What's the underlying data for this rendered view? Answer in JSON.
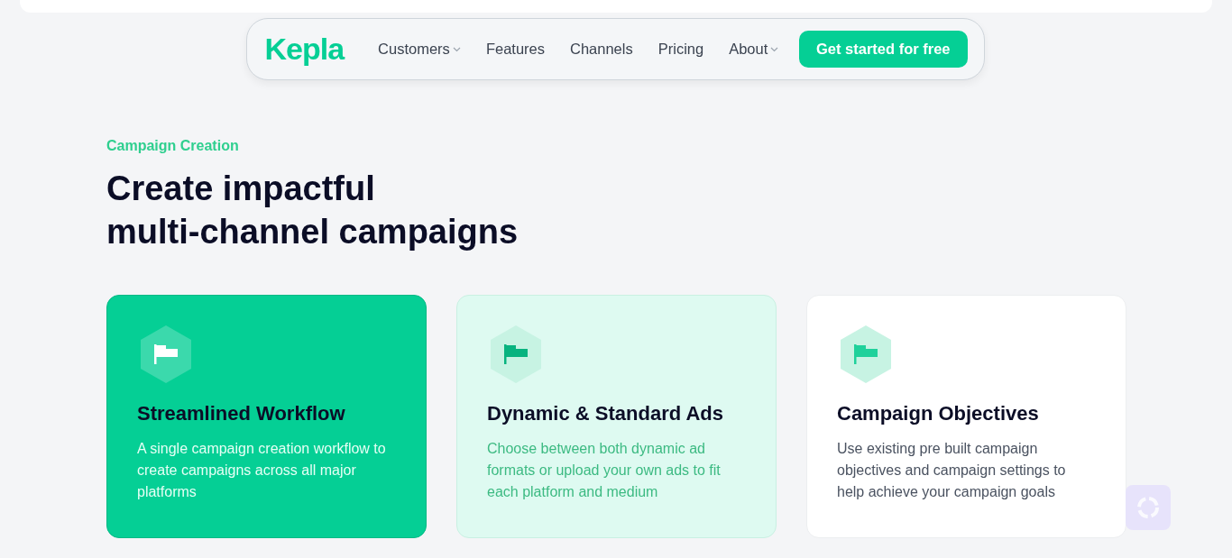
{
  "header": {
    "logo": "Kepla",
    "nav": [
      {
        "label": "Customers",
        "dropdown": true
      },
      {
        "label": "Features",
        "dropdown": false
      },
      {
        "label": "Channels",
        "dropdown": false
      },
      {
        "label": "Pricing",
        "dropdown": false
      },
      {
        "label": "About",
        "dropdown": true
      }
    ],
    "cta": "Get started for free"
  },
  "section": {
    "eyebrow": "Campaign Creation",
    "heading": [
      "Create impactful",
      "multi-channel campaigns"
    ],
    "cards": [
      {
        "kind": "filled",
        "title": "Streamlined Workflow",
        "text": "A single campaign creation workflow to create campaigns across all major platforms"
      },
      {
        "kind": "tint",
        "title": "Dynamic & Standard Ads",
        "text": "Choose between both dynamic ad formats or upload your own ads to fit each platform and medium"
      },
      {
        "kind": "plain",
        "title": "Campaign Objectives",
        "text": "Use existing pre built campaign objectives and campaign settings to help achieve your campaign goals"
      }
    ]
  }
}
